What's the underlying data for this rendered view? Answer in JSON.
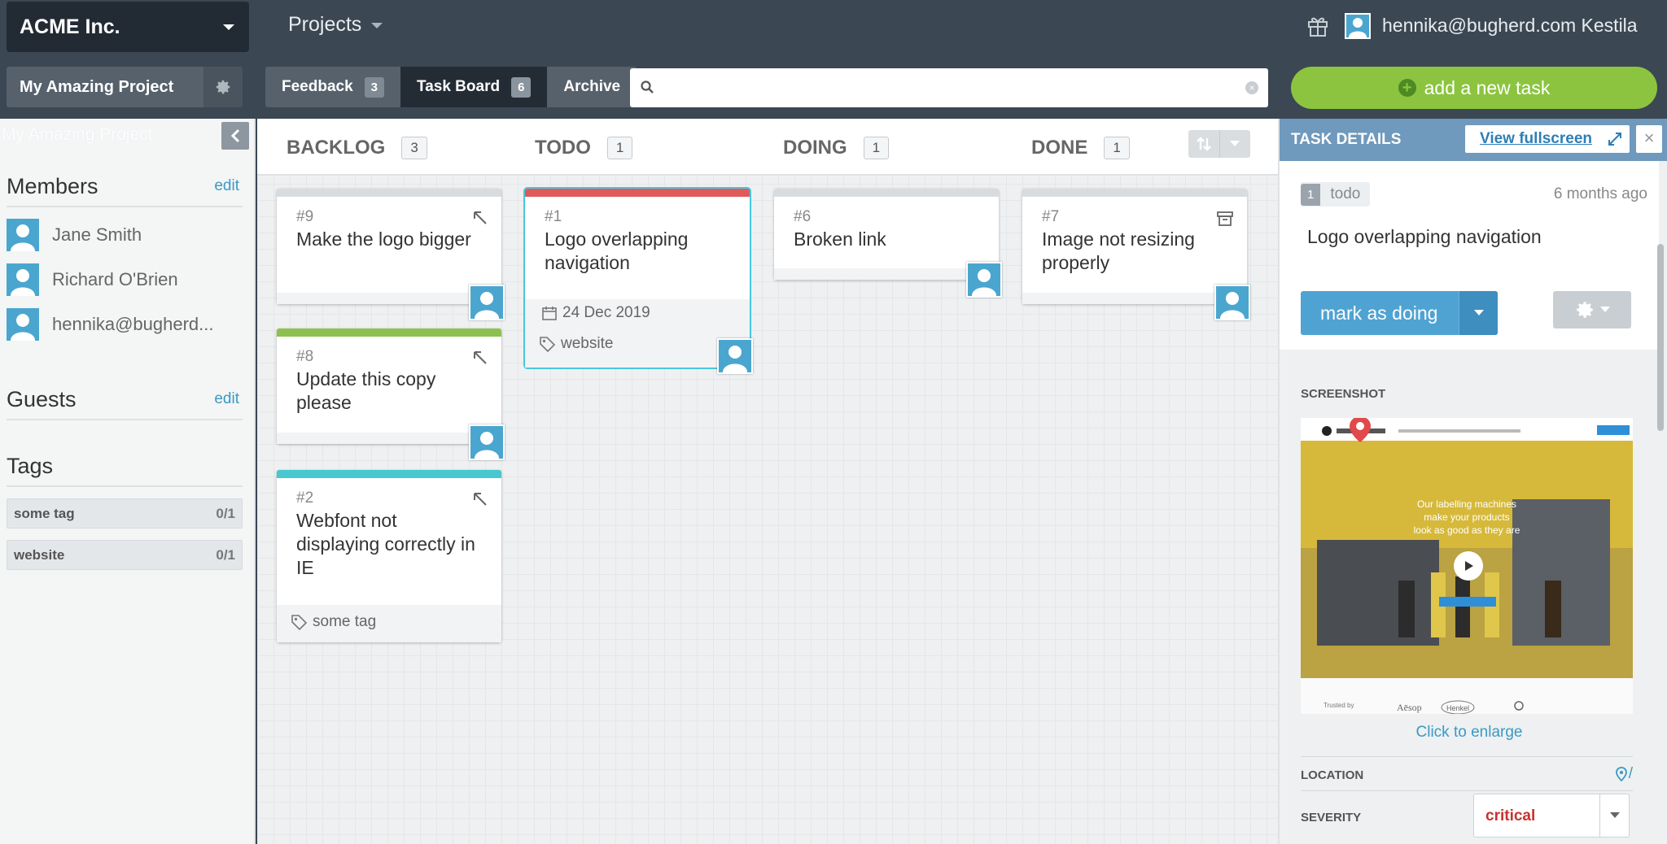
{
  "org": {
    "name": "ACME Inc."
  },
  "nav": {
    "projects_label": "Projects"
  },
  "user": {
    "email": "hennika@bugherd.com Kestila"
  },
  "project": {
    "name": "My Amazing Project"
  },
  "tabs": [
    {
      "label": "Feedback",
      "count": "3"
    },
    {
      "label": "Task Board",
      "count": "6"
    },
    {
      "label": "Archive"
    }
  ],
  "search": {
    "placeholder": "",
    "value": ""
  },
  "add_task": {
    "label": "add a new task"
  },
  "sidebar": {
    "ghost_title": "My Amazing Project",
    "members_heading": "Members",
    "members_edit": "edit",
    "members": [
      "Jane Smith",
      "Richard O'Brien",
      "hennika@bugherd..."
    ],
    "guests_heading": "Guests",
    "guests_edit": "edit",
    "tags_heading": "Tags",
    "tags": [
      {
        "name": "some tag",
        "count": "0/1"
      },
      {
        "name": "website",
        "count": "0/1"
      }
    ]
  },
  "board": {
    "columns": [
      {
        "title": "BACKLOG",
        "count": "3"
      },
      {
        "title": "TODO",
        "count": "1"
      },
      {
        "title": "DOING",
        "count": "1"
      },
      {
        "title": "DONE",
        "count": "1"
      }
    ],
    "cards": {
      "c9": {
        "num": "#9",
        "title": "Make the logo bigger",
        "bar": "#d9dcdf"
      },
      "c8": {
        "num": "#8",
        "title": "Update this copy please",
        "bar": "#8cc152"
      },
      "c2": {
        "num": "#2",
        "title": "Webfont not displaying correctly in IE",
        "tag": "some tag",
        "bar": "#48c7cf"
      },
      "c1": {
        "num": "#1",
        "title": "Logo overlapping navigation",
        "date": "24 Dec 2019",
        "tag": "website",
        "bar": "#e05a5a"
      },
      "c6": {
        "num": "#6",
        "title": "Broken link",
        "bar": "#d9dcdf"
      },
      "c7": {
        "num": "#7",
        "title": "Image not resizing properly",
        "bar": "#d9dcdf"
      }
    }
  },
  "details": {
    "heading": "TASK DETAILS",
    "view_fullscreen": "View fullscreen",
    "close": "×",
    "status_num": "1",
    "status": "todo",
    "ago": "6 months ago",
    "title": "Logo overlapping navigation",
    "mark_label": "mark as doing",
    "screenshot_label": "SCREENSHOT",
    "screenshot": {
      "headline_1": "Our labelling machines",
      "headline_2": "make your products",
      "headline_3": "look as good as they are",
      "trusted": "Trusted by",
      "brand_1": "Aēsop",
      "brand_2": "Henkel"
    },
    "enlarge": "Click to enlarge",
    "location_label": "LOCATION",
    "location_value": "/",
    "severity_label": "SEVERITY",
    "severity_value": "critical"
  },
  "colors": {
    "accent": "#4fa3d3",
    "add_green": "#8cc43f",
    "critical": "#c8322f",
    "panel_head": "#6f99bd"
  }
}
